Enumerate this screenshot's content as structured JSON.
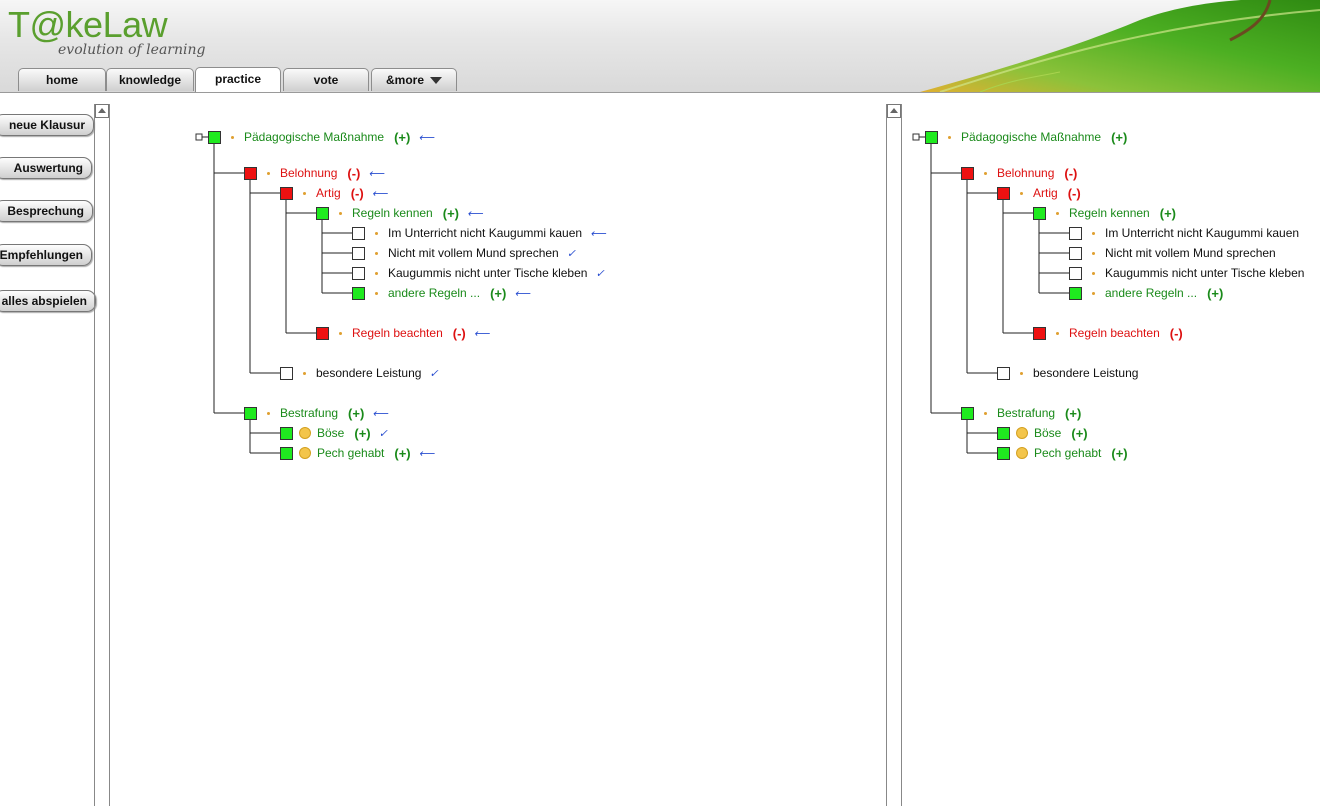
{
  "app": {
    "logo_prefix": "T",
    "logo_at": "@",
    "logo_rest": "keLaw",
    "tagline": "evolution of learning"
  },
  "tabs": [
    {
      "label": "home"
    },
    {
      "label": "knowledge"
    },
    {
      "label": "practice",
      "active": true
    },
    {
      "label": "vote"
    },
    {
      "label": "&more"
    }
  ],
  "sidebar": {
    "buttons": [
      {
        "label": "neue Klausur"
      },
      {
        "label": "Auswertung"
      },
      {
        "label": "Besprechung"
      },
      {
        "label": "Empfehlungen"
      },
      {
        "label": "alles abspielen"
      }
    ]
  },
  "colors": {
    "green_node": "#1fea1f",
    "red_node": "#ee1111",
    "green_text": "#1a8a1a",
    "red_text": "#dd1111",
    "annotation": "#2a4fd0"
  },
  "left_tree": {
    "nodes": [
      {
        "label": "Pädagogische Maßnahme",
        "status": "green",
        "sign": "(+)",
        "mark": "⟵"
      },
      {
        "label": "Belohnung",
        "status": "red",
        "sign": "(-)",
        "mark": "⟵"
      },
      {
        "label": "Artig",
        "status": "red",
        "sign": "(-)",
        "mark": "⟵"
      },
      {
        "label": "Regeln kennen",
        "status": "green",
        "sign": "(+)",
        "mark": "⟵"
      },
      {
        "label": "Im Unterricht nicht Kaugummi kauen",
        "status": "white",
        "sign": "",
        "mark": "⟵"
      },
      {
        "label": "Nicht mit vollem Mund sprechen",
        "status": "white",
        "sign": "",
        "mark": "✓"
      },
      {
        "label": "Kaugummis nicht unter Tische kleben",
        "status": "white",
        "sign": "",
        "mark": "✓"
      },
      {
        "label": "andere Regeln ...",
        "status": "green",
        "sign": "(+)",
        "mark": "⟵"
      },
      {
        "label": "Regeln beachten",
        "status": "red",
        "sign": "(-)",
        "mark": "⟵"
      },
      {
        "label": "besondere Leistung",
        "status": "white",
        "sign": "",
        "mark": "✓"
      },
      {
        "label": "Bestrafung",
        "status": "green",
        "sign": "(+)",
        "mark": "⟵"
      },
      {
        "label": "Böse",
        "status": "green",
        "sign": "(+)",
        "mark": "✓",
        "circle": true
      },
      {
        "label": "Pech gehabt",
        "status": "green",
        "sign": "(+)",
        "mark": "⟵",
        "circle": true
      }
    ]
  },
  "right_tree": {
    "nodes": [
      {
        "label": "Pädagogische Maßnahme",
        "status": "green",
        "sign": "(+)"
      },
      {
        "label": "Belohnung",
        "status": "red",
        "sign": "(-)"
      },
      {
        "label": "Artig",
        "status": "red",
        "sign": "(-)"
      },
      {
        "label": "Regeln kennen",
        "status": "green",
        "sign": "(+)"
      },
      {
        "label": "Im Unterricht nicht Kaugummi kauen",
        "status": "white",
        "sign": ""
      },
      {
        "label": "Nicht mit vollem Mund sprechen",
        "status": "white",
        "sign": ""
      },
      {
        "label": "Kaugummis nicht unter Tische kleben",
        "status": "white",
        "sign": ""
      },
      {
        "label": "andere Regeln ...",
        "status": "green",
        "sign": "(+)"
      },
      {
        "label": "Regeln beachten",
        "status": "red",
        "sign": "(-)"
      },
      {
        "label": "besondere Leistung",
        "status": "white",
        "sign": ""
      },
      {
        "label": "Bestrafung",
        "status": "green",
        "sign": "(+)"
      },
      {
        "label": "Böse",
        "status": "green",
        "sign": "(+)",
        "circle": true
      },
      {
        "label": "Pech gehabt",
        "status": "green",
        "sign": "(+)",
        "circle": true
      }
    ]
  }
}
